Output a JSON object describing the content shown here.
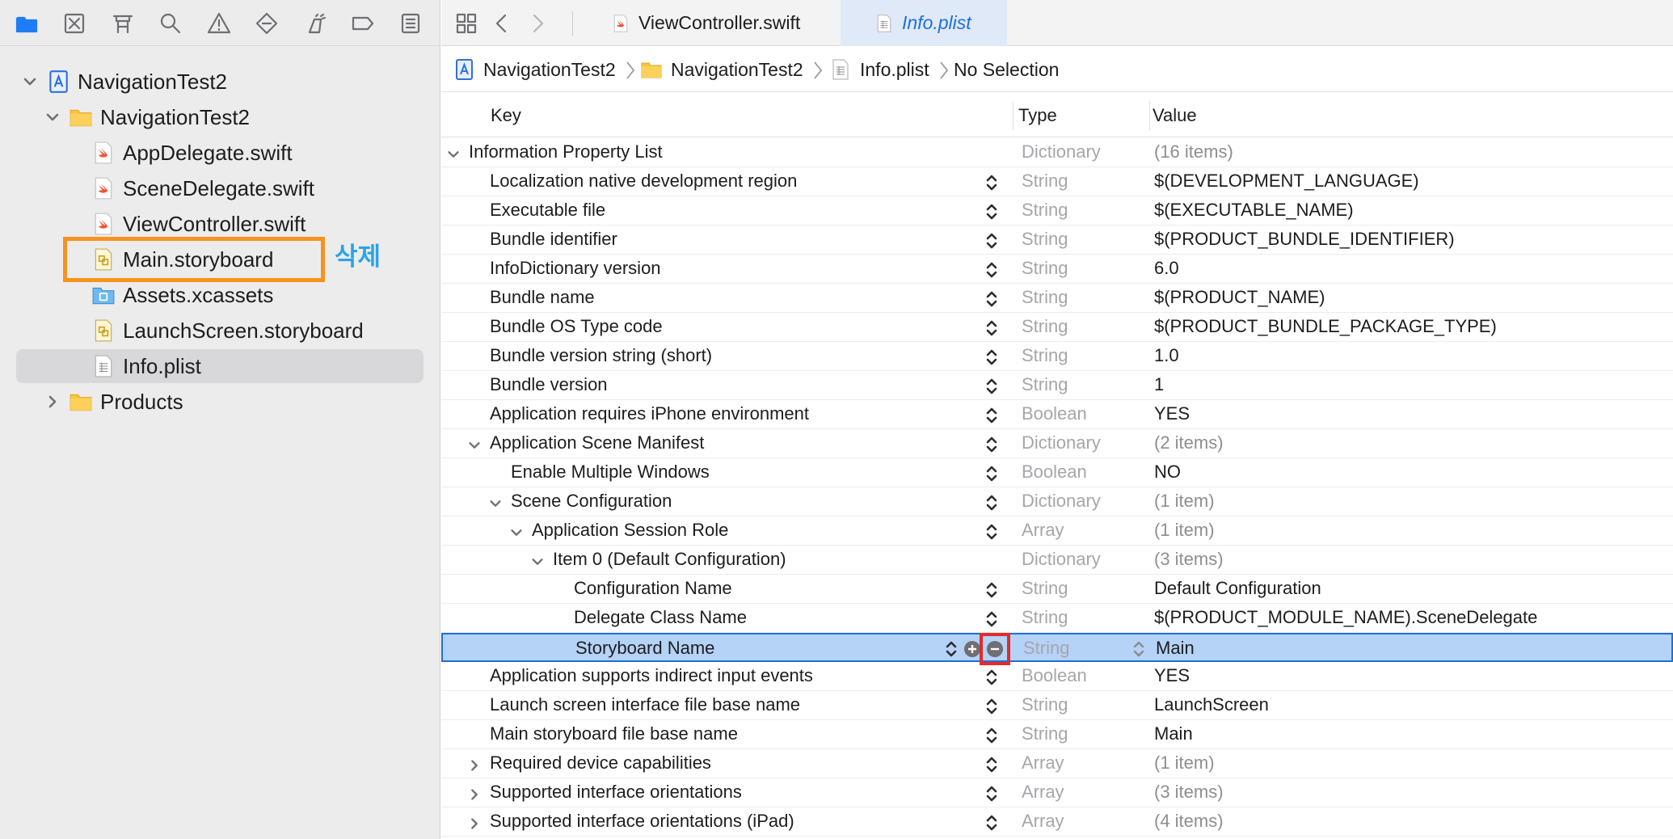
{
  "navigator": {
    "toolbar": [
      "folder-icon",
      "source-control-icon",
      "symbol-icon",
      "find-icon",
      "issue-icon",
      "test-icon",
      "debug-icon",
      "breakpoint-icon",
      "report-icon"
    ],
    "tree": [
      {
        "label": "NavigationTest2",
        "icon": "project-icon",
        "level": 0,
        "expanded": true
      },
      {
        "label": "NavigationTest2",
        "icon": "folder-icon",
        "level": 1,
        "expanded": true
      },
      {
        "label": "AppDelegate.swift",
        "icon": "swift-file-icon",
        "level": 2
      },
      {
        "label": "SceneDelegate.swift",
        "icon": "swift-file-icon",
        "level": 2
      },
      {
        "label": "ViewController.swift",
        "icon": "swift-file-icon",
        "level": 2
      },
      {
        "label": "Main.storyboard",
        "icon": "storyboard-file-icon",
        "level": 2,
        "highlighted": true
      },
      {
        "label": "Assets.xcassets",
        "icon": "asset-catalog-icon",
        "level": 2
      },
      {
        "label": "LaunchScreen.storyboard",
        "icon": "storyboard-file-icon",
        "level": 2
      },
      {
        "label": "Info.plist",
        "icon": "plist-file-icon",
        "level": 2,
        "selected": true
      },
      {
        "label": "Products",
        "icon": "folder-icon",
        "level": 1,
        "expanded": false
      }
    ],
    "annotation": "삭제",
    "colors": {
      "highlight": "#f7931e",
      "annotation": "#2aa3e6"
    }
  },
  "tabs": [
    {
      "label": "ViewController.swift",
      "icon": "swift-file-icon",
      "active": false
    },
    {
      "label": "Info.plist",
      "icon": "plist-file-icon",
      "active": true
    }
  ],
  "breadcrumb": [
    {
      "label": "NavigationTest2",
      "icon": "project-icon"
    },
    {
      "label": "NavigationTest2",
      "icon": "folder-icon"
    },
    {
      "label": "Info.plist",
      "icon": "plist-file-icon"
    },
    {
      "label": "No Selection",
      "icon": ""
    }
  ],
  "plist": {
    "columns": {
      "key": "Key",
      "type": "Type",
      "value": "Value"
    },
    "rows": [
      {
        "key": "Information Property List",
        "type": "Dictionary",
        "value": "(16 items)",
        "level": 0,
        "disclosure": "expanded",
        "stepper": false
      },
      {
        "key": "Localization native development region",
        "type": "String",
        "value": "$(DEVELOPMENT_LANGUAGE)",
        "level": 1,
        "disclosure": "",
        "stepper": true
      },
      {
        "key": "Executable file",
        "type": "String",
        "value": "$(EXECUTABLE_NAME)",
        "level": 1,
        "disclosure": "",
        "stepper": true
      },
      {
        "key": "Bundle identifier",
        "type": "String",
        "value": "$(PRODUCT_BUNDLE_IDENTIFIER)",
        "level": 1,
        "disclosure": "",
        "stepper": true
      },
      {
        "key": "InfoDictionary version",
        "type": "String",
        "value": "6.0",
        "level": 1,
        "disclosure": "",
        "stepper": true
      },
      {
        "key": "Bundle name",
        "type": "String",
        "value": "$(PRODUCT_NAME)",
        "level": 1,
        "disclosure": "",
        "stepper": true
      },
      {
        "key": "Bundle OS Type code",
        "type": "String",
        "value": "$(PRODUCT_BUNDLE_PACKAGE_TYPE)",
        "level": 1,
        "disclosure": "",
        "stepper": true
      },
      {
        "key": "Bundle version string (short)",
        "type": "String",
        "value": "1.0",
        "level": 1,
        "disclosure": "",
        "stepper": true
      },
      {
        "key": "Bundle version",
        "type": "String",
        "value": "1",
        "level": 1,
        "disclosure": "",
        "stepper": true
      },
      {
        "key": "Application requires iPhone environment",
        "type": "Boolean",
        "value": "YES",
        "level": 1,
        "disclosure": "",
        "stepper": true
      },
      {
        "key": "Application Scene Manifest",
        "type": "Dictionary",
        "value": "(2 items)",
        "level": 1,
        "disclosure": "expanded",
        "stepper": true
      },
      {
        "key": "Enable Multiple Windows",
        "type": "Boolean",
        "value": "NO",
        "level": 2,
        "disclosure": "",
        "stepper": true
      },
      {
        "key": "Scene Configuration",
        "type": "Dictionary",
        "value": "(1 item)",
        "level": 2,
        "disclosure": "expanded",
        "stepper": true
      },
      {
        "key": "Application Session Role",
        "type": "Array",
        "value": "(1 item)",
        "level": 3,
        "disclosure": "expanded",
        "stepper": true
      },
      {
        "key": "Item 0 (Default Configuration)",
        "type": "Dictionary",
        "value": "(3 items)",
        "level": 4,
        "disclosure": "expanded",
        "stepper": false
      },
      {
        "key": "Configuration Name",
        "type": "String",
        "value": "Default Configuration",
        "level": 5,
        "disclosure": "",
        "stepper": true
      },
      {
        "key": "Delegate Class Name",
        "type": "String",
        "value": "$(PRODUCT_MODULE_NAME).SceneDelegate",
        "level": 5,
        "disclosure": "",
        "stepper": true
      },
      {
        "key": "Storyboard Name",
        "type": "String",
        "value": "Main",
        "level": 5,
        "disclosure": "",
        "stepper": true,
        "selected": true
      },
      {
        "key": "Application supports indirect input events",
        "type": "Boolean",
        "value": "YES",
        "level": 1,
        "disclosure": "",
        "stepper": true
      },
      {
        "key": "Launch screen interface file base name",
        "type": "String",
        "value": "LaunchScreen",
        "level": 1,
        "disclosure": "",
        "stepper": true
      },
      {
        "key": "Main storyboard file base name",
        "type": "String",
        "value": "Main",
        "level": 1,
        "disclosure": "",
        "stepper": true
      },
      {
        "key": "Required device capabilities",
        "type": "Array",
        "value": "(1 item)",
        "level": 1,
        "disclosure": "collapsed",
        "stepper": true
      },
      {
        "key": "Supported interface orientations",
        "type": "Array",
        "value": "(3 items)",
        "level": 1,
        "disclosure": "collapsed",
        "stepper": true
      },
      {
        "key": "Supported interface orientations (iPad)",
        "type": "Array",
        "value": "(4 items)",
        "level": 1,
        "disclosure": "collapsed",
        "stepper": true
      }
    ],
    "colors": {
      "selection": "#b5d2f7",
      "selection_border": "#1f6fd8",
      "remove_highlight": "#e32b2b"
    }
  }
}
